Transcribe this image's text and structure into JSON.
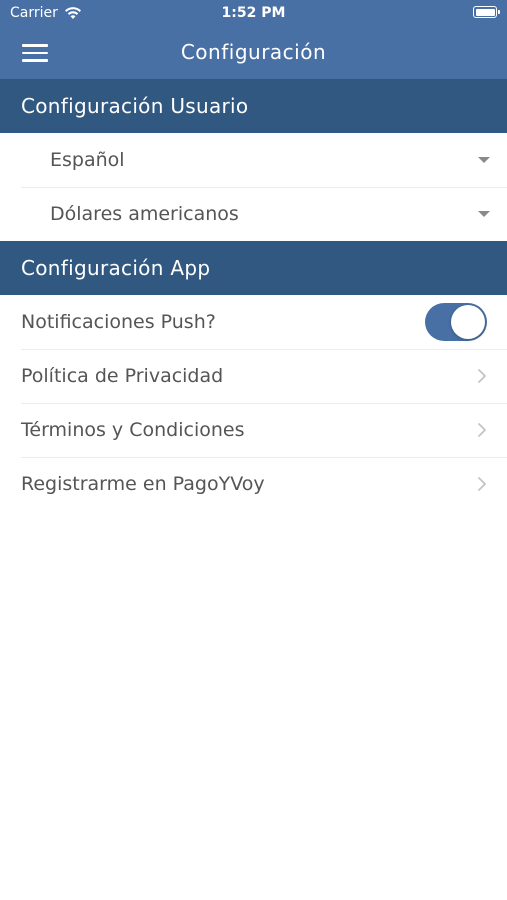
{
  "status_bar": {
    "carrier": "Carrier",
    "time": "1:52 PM",
    "icons": [
      "wifi-icon",
      "battery-icon"
    ]
  },
  "nav": {
    "title": "Configuración",
    "menu_icon": "hamburger-menu-icon"
  },
  "sections": {
    "user": {
      "title": "Configuración Usuario",
      "items": [
        {
          "label": "Español",
          "control": "dropdown"
        },
        {
          "label": "Dólares americanos",
          "control": "dropdown"
        }
      ]
    },
    "app": {
      "title": "Configuración App",
      "items": [
        {
          "label": "Notificaciones Push?",
          "control": "toggle",
          "value": true
        },
        {
          "label": "Política de Privacidad",
          "control": "chevron"
        },
        {
          "label": "Términos y Condiciones",
          "control": "chevron"
        },
        {
          "label": "Registrarme en PagoYVoy",
          "control": "chevron"
        }
      ]
    }
  },
  "colors": {
    "nav_background": "#4870a5",
    "section_header": "#315880",
    "toggle_on": "#4870a5",
    "row_text": "#555555"
  }
}
